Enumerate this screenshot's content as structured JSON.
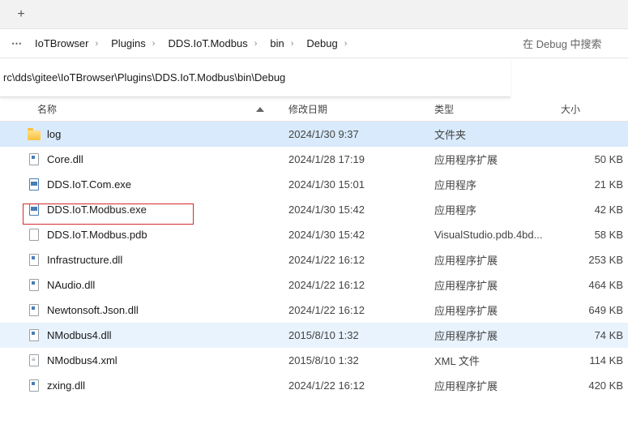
{
  "tab": {
    "new_tab_label": "+"
  },
  "breadcrumb": {
    "more": "⋯",
    "items": [
      "IoTBrowser",
      "Plugins",
      "DDS.IoT.Modbus",
      "bin",
      "Debug"
    ]
  },
  "search": {
    "placeholder": "在 Debug 中搜索"
  },
  "path": "rc\\dds\\gitee\\IoTBrowser\\Plugins\\DDS.IoT.Modbus\\bin\\Debug",
  "columns": {
    "name": "名称",
    "date": "修改日期",
    "type": "类型",
    "size": "大小"
  },
  "files": [
    {
      "name": "log",
      "date": "2024/1/30 9:37",
      "type": "文件夹",
      "size": "",
      "icon": "folder"
    },
    {
      "name": "Core.dll",
      "date": "2024/1/28 17:19",
      "type": "应用程序扩展",
      "size": "50 KB",
      "icon": "dll"
    },
    {
      "name": "DDS.IoT.Com.exe",
      "date": "2024/1/30 15:01",
      "type": "应用程序",
      "size": "21 KB",
      "icon": "exe"
    },
    {
      "name": "DDS.IoT.Modbus.exe",
      "date": "2024/1/30 15:42",
      "type": "应用程序",
      "size": "42 KB",
      "icon": "exe"
    },
    {
      "name": "DDS.IoT.Modbus.pdb",
      "date": "2024/1/30 15:42",
      "type": "VisualStudio.pdb.4bd...",
      "size": "58 KB",
      "icon": "file"
    },
    {
      "name": "Infrastructure.dll",
      "date": "2024/1/22 16:12",
      "type": "应用程序扩展",
      "size": "253 KB",
      "icon": "dll"
    },
    {
      "name": "NAudio.dll",
      "date": "2024/1/22 16:12",
      "type": "应用程序扩展",
      "size": "464 KB",
      "icon": "dll"
    },
    {
      "name": "Newtonsoft.Json.dll",
      "date": "2024/1/22 16:12",
      "type": "应用程序扩展",
      "size": "649 KB",
      "icon": "dll"
    },
    {
      "name": "NModbus4.dll",
      "date": "2015/8/10 1:32",
      "type": "应用程序扩展",
      "size": "74 KB",
      "icon": "dll"
    },
    {
      "name": "NModbus4.xml",
      "date": "2015/8/10 1:32",
      "type": "XML 文件",
      "size": "114 KB",
      "icon": "doc"
    },
    {
      "name": "zxing.dll",
      "date": "2024/1/22 16:12",
      "type": "应用程序扩展",
      "size": "420 KB",
      "icon": "dll"
    }
  ],
  "highlight_index": 3,
  "selected_index": 0,
  "hover_index": 8
}
